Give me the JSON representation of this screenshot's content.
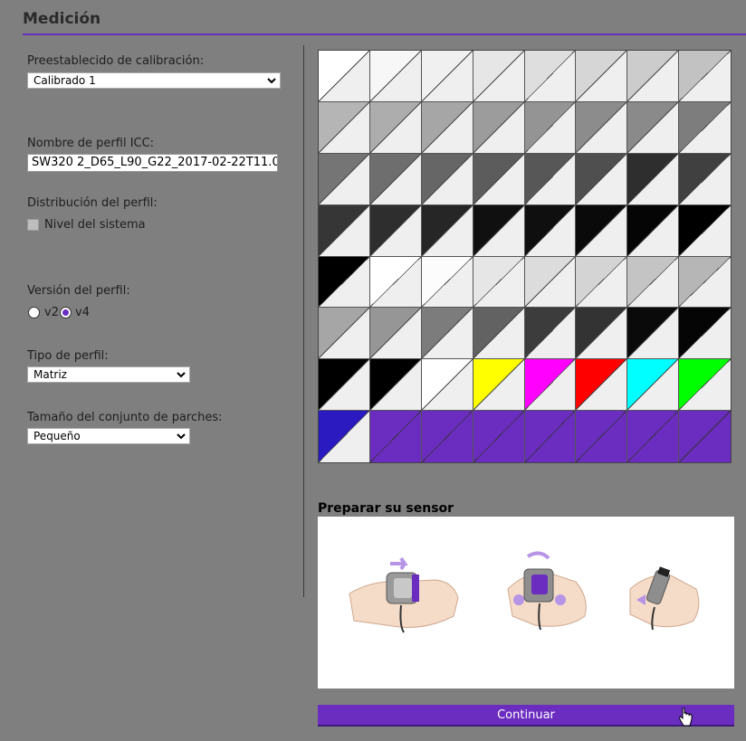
{
  "header": {
    "title": "Medición"
  },
  "form": {
    "preset_label": "Preestablecido de calibración:",
    "preset_value": "Calibrado 1",
    "icc_label": "Nombre de perfil ICC:",
    "icc_value": "SW320 2_D65_L90_G22_2017-02-22T11.0",
    "distribution_label": "Distribución del perfil:",
    "system_level_label": "Nivel del sistema",
    "system_level_checked": false,
    "version_label": "Versión del perfil:",
    "version_options": [
      "v2",
      "v4"
    ],
    "version_selected": "v4",
    "profile_type_label": "Tipo de perfil:",
    "profile_type_value": "Matriz",
    "patch_set_label": "Tamaño del conjunto de parches:",
    "patch_set_value": "Pequeño"
  },
  "patches": [
    [
      "#ffffff",
      "#f7f7f7",
      "#f0f0f0",
      "#e6e6e6",
      "#dedede",
      "#d6d6d6",
      "#cccccc",
      "#c2c2c2"
    ],
    [
      "#b5b5b5",
      "#adadad",
      "#a6a6a6",
      "#9c9c9c",
      "#949494",
      "#8c8c8c",
      "#8a8a8a",
      "#7d7d7d"
    ],
    [
      "#757575",
      "#6e6e6e",
      "#666666",
      "#5c5c5c",
      "#575757",
      "#4f4f4f",
      "#2e2e2e",
      "#404040"
    ],
    [
      "#363636",
      "#2e2e2e",
      "#262626",
      "#101010",
      "#0f0f0f",
      "#0a0a0a",
      "#050505",
      "#000000"
    ],
    [
      "#000000",
      "#ffffff",
      "#fcfcfc",
      "#e6e6e6",
      "#dcdcdc",
      "#d4d4d4",
      "#c4c4c4",
      "#b6b6b6"
    ],
    [
      "#a6a6a6",
      "#969696",
      "#7c7c7c",
      "#626262",
      "#3c3c3c",
      "#333333",
      "#0a0a0a",
      "#050505"
    ],
    [
      "#000000",
      "#000000",
      "#ffffff",
      "#ffff00",
      "#ff00ff",
      "#ff0000",
      "#00ffff",
      "#00ff00"
    ],
    [
      "#2a1ac0",
      "#6a2dbf",
      "#6a2dbf",
      "#6a2dbf",
      "#6a2dbf",
      "#6a2dbf",
      "#6a2dbf",
      "#6a2dbf"
    ]
  ],
  "sensor": {
    "title": "Preparar su sensor"
  },
  "actions": {
    "continue_label": "Continuar"
  },
  "colors": {
    "accent": "#6a2dbf",
    "background": "#7f7f7f"
  }
}
